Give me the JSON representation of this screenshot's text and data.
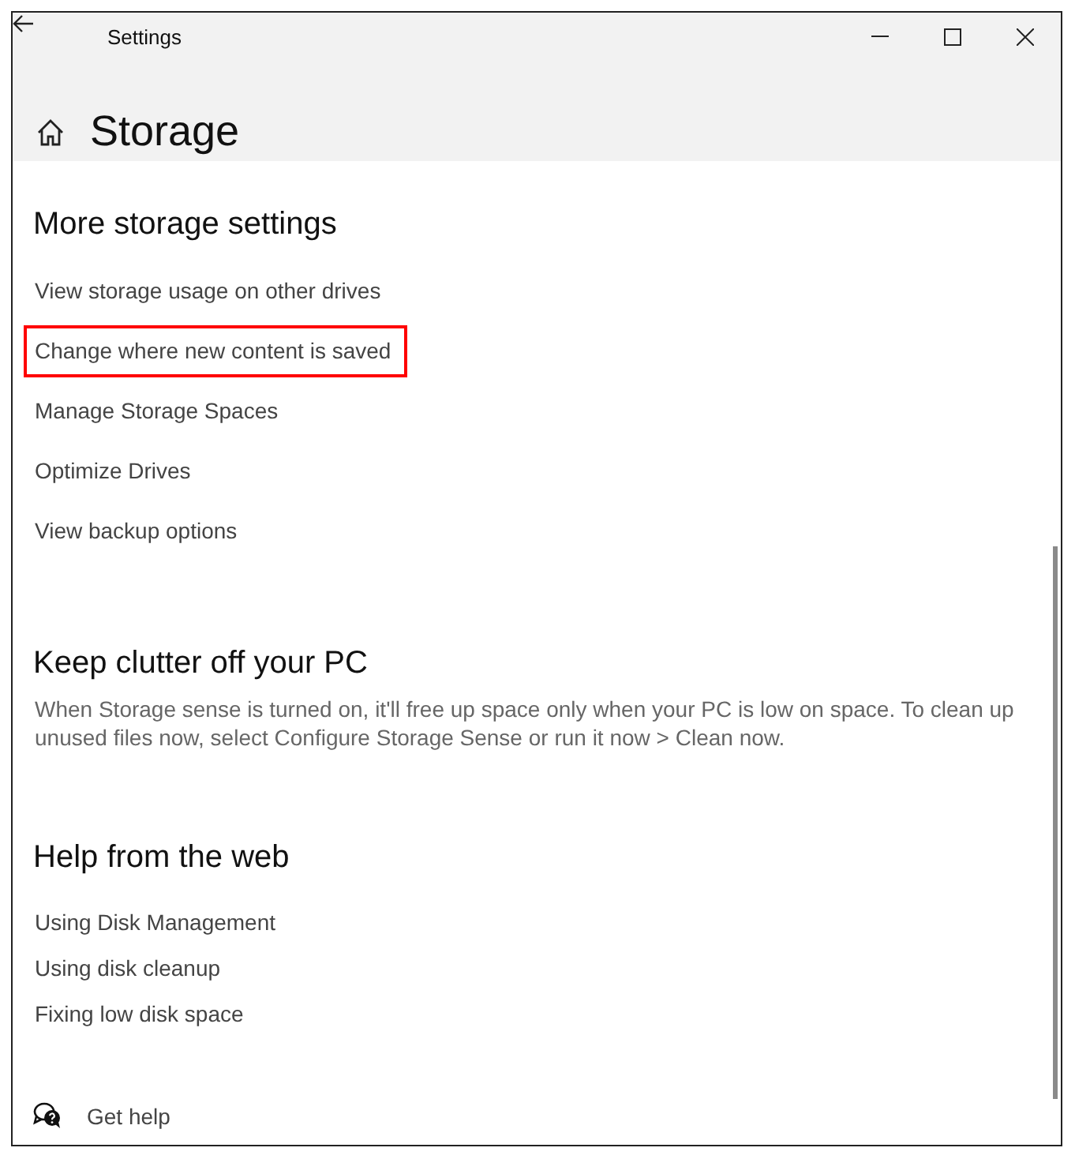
{
  "window": {
    "title": "Settings"
  },
  "page": {
    "title": "Storage"
  },
  "sections": [
    {
      "heading": "More storage settings",
      "kind": "settings_links",
      "links": [
        {
          "label": "View storage usage on other drives",
          "highlighted": false
        },
        {
          "label": "Change where new content is saved",
          "highlighted": true
        },
        {
          "label": "Manage Storage Spaces",
          "highlighted": false
        },
        {
          "label": "Optimize Drives",
          "highlighted": false
        },
        {
          "label": "View backup options",
          "highlighted": false
        }
      ]
    },
    {
      "heading": "Keep clutter off your PC",
      "kind": "text",
      "text": "When Storage sense is turned on, it'll free up space only when your PC is low on space. To clean up unused files now, select Configure Storage Sense or run it now > Clean now."
    },
    {
      "heading": "Help from the web",
      "kind": "web_links",
      "links": [
        {
          "label": "Using Disk Management",
          "highlighted": false
        },
        {
          "label": "Using disk cleanup",
          "highlighted": false
        },
        {
          "label": "Fixing low disk space",
          "highlighted": false
        }
      ]
    }
  ],
  "footer": {
    "label": "Get help"
  }
}
